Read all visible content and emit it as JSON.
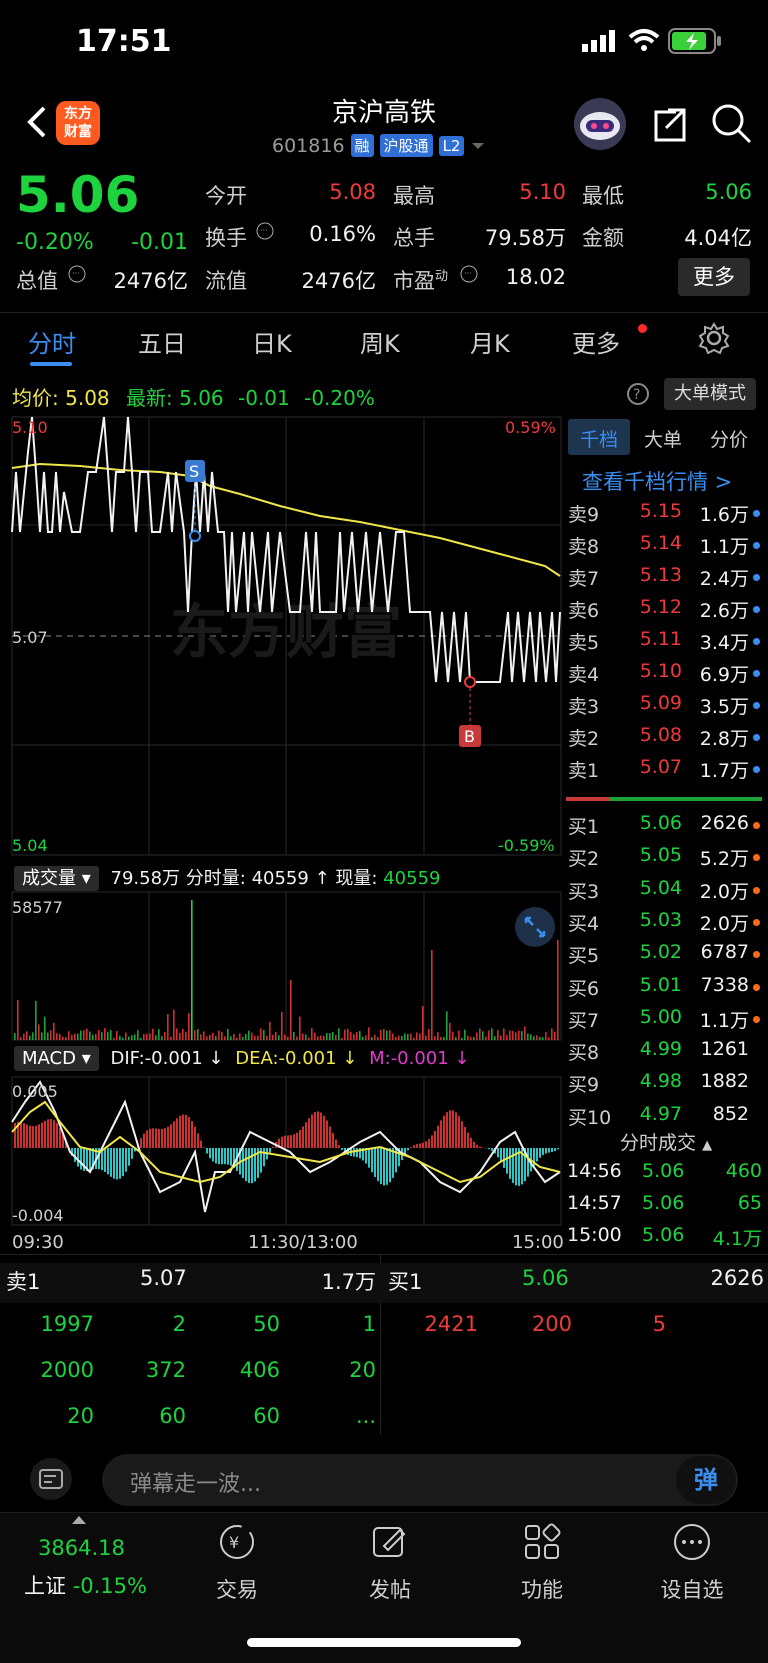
{
  "status": {
    "time": "17:51"
  },
  "header": {
    "logo_line1": "东方",
    "logo_line2": "财富",
    "name": "京沪高铁",
    "code": "601816",
    "tags": [
      "融",
      "沪股通",
      "L2"
    ]
  },
  "quote": {
    "price": "5.06",
    "change_pct": "-0.20%",
    "change": "-0.01",
    "open_label": "今开",
    "open": "5.08",
    "high_label": "最高",
    "high": "5.10",
    "low_label": "最低",
    "low": "5.06",
    "turnover_label": "换手",
    "turnover": "0.16%",
    "volume_label": "总手",
    "volume": "79.58万",
    "amount_label": "金额",
    "amount": "4.04亿",
    "mktcap_label": "总值",
    "mktcap": "2476亿",
    "float_label": "流值",
    "float": "2476亿",
    "pe_label": "市盈",
    "pe_sup": "动",
    "pe": "18.02",
    "more": "更多"
  },
  "tabs": [
    "分时",
    "五日",
    "日K",
    "周K",
    "月K",
    "更多"
  ],
  "info": {
    "avg_label": "均价:",
    "avg": "5.08",
    "last_label": "最新:",
    "last": "5.06",
    "last_chg": "-0.01",
    "last_pct": "-0.20%",
    "big_order": "大单模式"
  },
  "chart_labels": {
    "top_price": "5.10",
    "top_pct": "0.59%",
    "mid_price": "5.07",
    "bottom_price": "5.04",
    "bottom_pct": "-0.59%",
    "watermark": "东方财富",
    "marker_s": "S",
    "marker_b": "B",
    "time_start": "09:30",
    "time_mid": "11:30/13:00",
    "time_end": "15:00"
  },
  "volume": {
    "selector": "成交量",
    "total": "79.58万",
    "tick_label": "分时量:",
    "tick": "40559",
    "arrow": "↑",
    "now_label": "现量:",
    "now": "40559",
    "max": "58577"
  },
  "macd": {
    "selector": "MACD",
    "dif": "DIF:-0.001 ↓",
    "dea": "DEA:-0.001 ↓",
    "m": "M:-0.001 ↓",
    "top": "0.005",
    "bottom": "-0.004"
  },
  "right_panel": {
    "tabs": [
      "千档",
      "大单",
      "分价"
    ],
    "view_link": "查看千档行情 >",
    "asks": [
      {
        "label": "卖9",
        "price": "5.15",
        "vol": "1.6万"
      },
      {
        "label": "卖8",
        "price": "5.14",
        "vol": "1.1万"
      },
      {
        "label": "卖7",
        "price": "5.13",
        "vol": "2.4万"
      },
      {
        "label": "卖6",
        "price": "5.12",
        "vol": "2.6万"
      },
      {
        "label": "卖5",
        "price": "5.11",
        "vol": "3.4万"
      },
      {
        "label": "卖4",
        "price": "5.10",
        "vol": "6.9万"
      },
      {
        "label": "卖3",
        "price": "5.09",
        "vol": "3.5万"
      },
      {
        "label": "卖2",
        "price": "5.08",
        "vol": "2.8万"
      },
      {
        "label": "卖1",
        "price": "5.07",
        "vol": "1.7万"
      }
    ],
    "bids": [
      {
        "label": "买1",
        "price": "5.06",
        "vol": "2626"
      },
      {
        "label": "买2",
        "price": "5.05",
        "vol": "5.2万"
      },
      {
        "label": "买3",
        "price": "5.04",
        "vol": "2.0万"
      },
      {
        "label": "买4",
        "price": "5.03",
        "vol": "2.0万"
      },
      {
        "label": "买5",
        "price": "5.02",
        "vol": "6787"
      },
      {
        "label": "买6",
        "price": "5.01",
        "vol": "7338"
      },
      {
        "label": "买7",
        "price": "5.00",
        "vol": "1.1万"
      },
      {
        "label": "买8",
        "price": "4.99",
        "vol": "1261"
      },
      {
        "label": "买9",
        "price": "4.98",
        "vol": "1882"
      },
      {
        "label": "买10",
        "price": "4.97",
        "vol": "852"
      }
    ],
    "trades_title": "分时成交",
    "trades": [
      {
        "time": "14:56",
        "price": "5.06",
        "vol": "460"
      },
      {
        "time": "14:57",
        "price": "5.06",
        "vol": "65"
      },
      {
        "time": "15:00",
        "price": "5.06",
        "vol": "4.1万"
      }
    ]
  },
  "queue": {
    "ask_label": "卖1",
    "ask_price": "5.07",
    "ask_vol": "1.7万",
    "bid_label": "买1",
    "bid_price": "5.06",
    "bid_vol": "2626",
    "ask_rows": [
      [
        "1997",
        "2",
        "50",
        "1"
      ],
      [
        "2000",
        "372",
        "406",
        "20"
      ],
      [
        "20",
        "60",
        "60",
        "..."
      ]
    ],
    "bid_rows": [
      [
        "2421",
        "200",
        "5"
      ]
    ]
  },
  "comment": {
    "placeholder": "弹幕走一波...",
    "danmu": "弹"
  },
  "nav": {
    "index_value": "3864.18",
    "index_name": "上证",
    "index_chg": "-0.15%",
    "items": [
      "交易",
      "发帖",
      "功能",
      "设自选"
    ]
  }
}
